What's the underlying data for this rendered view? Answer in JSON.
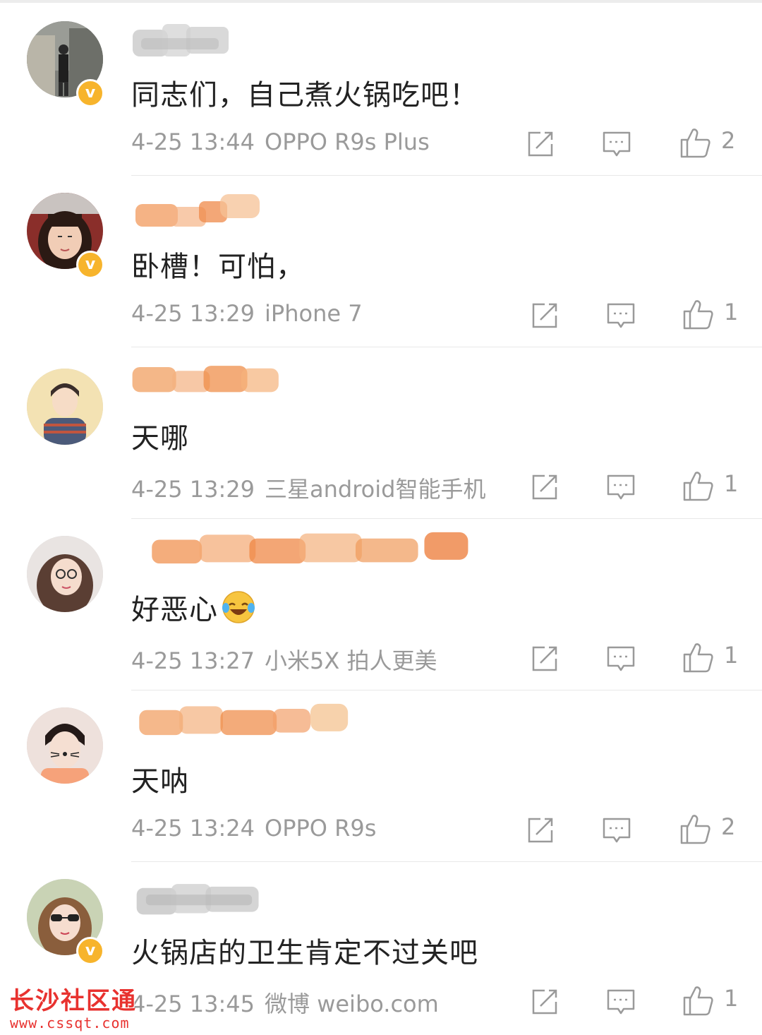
{
  "comments": [
    {
      "text": "同志们，自己煮火锅吃吧！",
      "time": "4-25 13:44",
      "device": "OPPO R9s Plus",
      "likes": "2",
      "verified": true,
      "nick_blur": "gray"
    },
    {
      "text": "卧槽！可怕，",
      "time": "4-25 13:29",
      "device": "iPhone 7",
      "likes": "1",
      "verified": true,
      "nick_blur": "orange"
    },
    {
      "text": "天哪",
      "time": "4-25 13:29",
      "device": "三星android智能手机",
      "likes": "1",
      "verified": false,
      "nick_blur": "orange"
    },
    {
      "text": "好恶心",
      "time": "4-25 13:27",
      "device": "小米5X 拍人更美",
      "likes": "1",
      "verified": false,
      "nick_blur": "orange",
      "emoji": "laugh-cry-icon"
    },
    {
      "text": "天呐",
      "time": "4-25 13:24",
      "device": "OPPO R9s",
      "likes": "2",
      "verified": false,
      "nick_blur": "orange"
    },
    {
      "text": "火锅店的卫生肯定不过关吧",
      "time": "4-25 13:45",
      "device": "微博 weibo.com",
      "likes": "1",
      "verified": true,
      "nick_blur": "gray"
    }
  ],
  "icons": {
    "share": "share-icon",
    "comment": "comment-icon",
    "like": "thumbs-up-icon",
    "verified": "verified-badge-icon"
  },
  "watermark": {
    "title": "长沙社区通",
    "url": "www.cssqt.com"
  },
  "colors": {
    "meta_text": "#9a9a9a",
    "badge": "#f7b42c",
    "watermark": "#e8322f"
  }
}
